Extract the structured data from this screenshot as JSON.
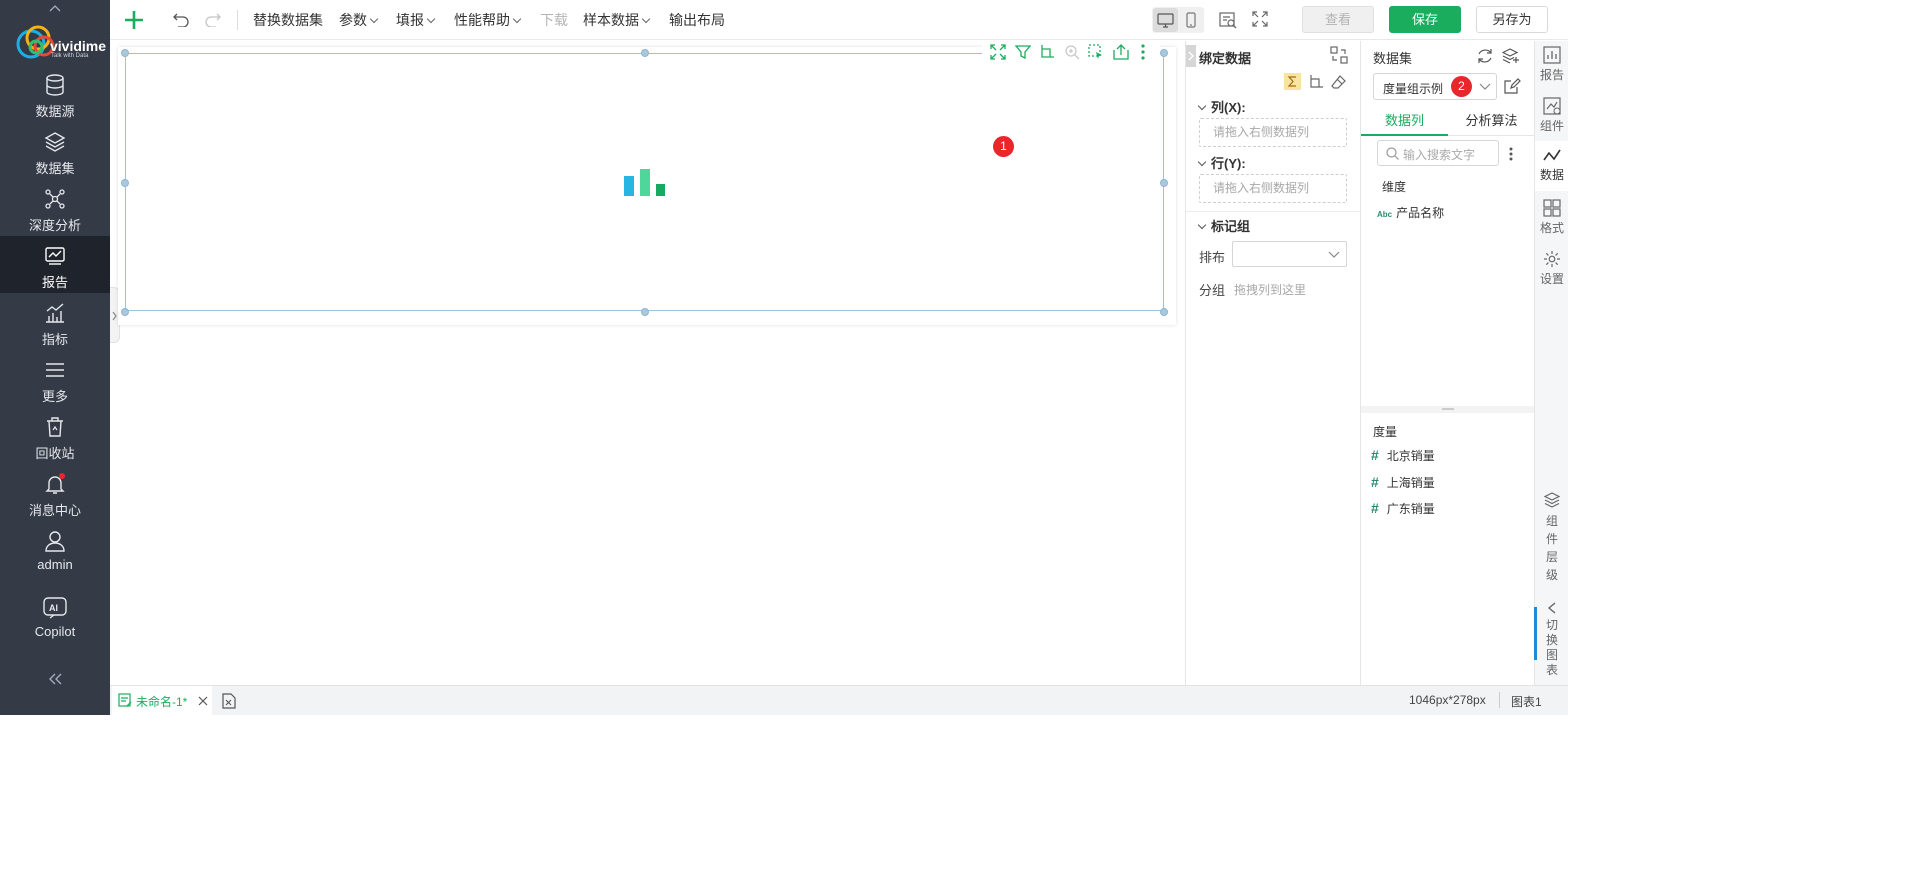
{
  "brand": {
    "name": "vividime",
    "tagline": "Talk with Data"
  },
  "nav": {
    "items": [
      {
        "label": "数据源",
        "icon": "database-icon"
      },
      {
        "label": "数据集",
        "icon": "layers-icon"
      },
      {
        "label": "深度分析",
        "icon": "network-icon"
      },
      {
        "label": "报告",
        "icon": "report-icon",
        "active": true
      },
      {
        "label": "指标",
        "icon": "metric-icon"
      },
      {
        "label": "更多",
        "icon": "menu-icon"
      },
      {
        "label": "回收站",
        "icon": "recycle-bin-icon"
      },
      {
        "label": "消息中心",
        "icon": "bell-icon"
      },
      {
        "label": "admin",
        "icon": "user-icon"
      },
      {
        "label": "Copilot",
        "icon": "ai-icon"
      }
    ],
    "collapse_icon": "double-chevron-left-icon"
  },
  "toolbar": {
    "menus": [
      {
        "label": "替换数据集",
        "dropdown": false,
        "disabled": false
      },
      {
        "label": "参数",
        "dropdown": true,
        "disabled": false
      },
      {
        "label": "填报",
        "dropdown": true,
        "disabled": false
      },
      {
        "label": "性能帮助",
        "dropdown": true,
        "disabled": false
      },
      {
        "label": "下载",
        "dropdown": false,
        "disabled": true
      },
      {
        "label": "样本数据",
        "dropdown": true,
        "disabled": false
      },
      {
        "label": "输出布局",
        "dropdown": false,
        "disabled": false
      }
    ],
    "view_label": "查看",
    "save_label": "保存",
    "save_as_label": "另存为",
    "accent": "#1aad5e"
  },
  "canvas": {
    "badge": "1"
  },
  "bind_panel": {
    "title": "绑定数据",
    "columns_label": "列(X):",
    "columns_placeholder": "请拖入右侧数据列",
    "rows_label": "行(Y):",
    "rows_placeholder": "请拖入右侧数据列",
    "mark_group_label": "标记组",
    "layout_label": "排布",
    "layout_value": "",
    "group_label": "分组",
    "group_placeholder": "拖拽列到这里"
  },
  "dataset_panel": {
    "title": "数据集",
    "selected_dataset": "度量组示例",
    "badge": "2",
    "tabs": [
      {
        "label": "数据列",
        "active": true
      },
      {
        "label": "分析算法",
        "active": false
      }
    ],
    "search_placeholder": "输入搜索文字",
    "dimension_header": "维度",
    "dimensions": [
      {
        "type": "Abc",
        "name": "产品名称"
      }
    ],
    "measure_header": "度量",
    "measures": [
      {
        "name": "北京销量"
      },
      {
        "name": "上海销量"
      },
      {
        "name": "广东销量"
      }
    ]
  },
  "right_rail": {
    "items": [
      {
        "label": "报告",
        "icon": "bar-chart-icon"
      },
      {
        "label": "组件",
        "icon": "component-icon"
      },
      {
        "label": "数据",
        "icon": "data-line-icon",
        "active": true
      },
      {
        "label": "格式",
        "icon": "grid-icon"
      },
      {
        "label": "设置",
        "icon": "gear-icon"
      }
    ],
    "layers_label": "组件层级",
    "switch_label": "切换图表"
  },
  "statusbar": {
    "tab_name": "未命名-1*",
    "size": "1046px*278px",
    "component": "图表1"
  }
}
